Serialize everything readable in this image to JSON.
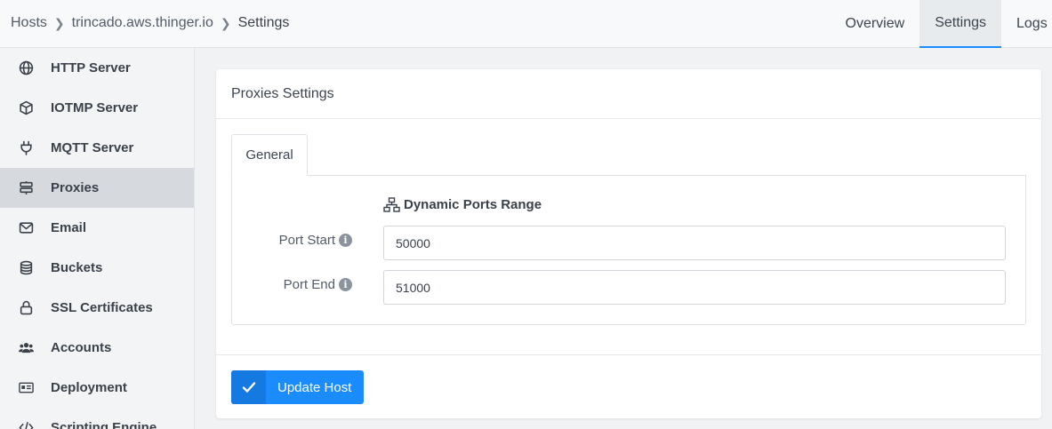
{
  "breadcrumb": {
    "items": [
      "Hosts",
      "trincado.aws.thinger.io",
      "Settings"
    ]
  },
  "top_tabs": [
    {
      "label": "Overview",
      "active": false
    },
    {
      "label": "Settings",
      "active": true
    },
    {
      "label": "Logs",
      "active": false
    }
  ],
  "sidebar": {
    "items": [
      {
        "label": "HTTP Server",
        "icon": "globe-icon"
      },
      {
        "label": "IOTMP Server",
        "icon": "cube-icon"
      },
      {
        "label": "MQTT Server",
        "icon": "plug-icon"
      },
      {
        "label": "Proxies",
        "icon": "signs-icon",
        "active": true
      },
      {
        "label": "Email",
        "icon": "envelope-icon"
      },
      {
        "label": "Buckets",
        "icon": "database-icon"
      },
      {
        "label": "SSL Certificates",
        "icon": "lock-icon"
      },
      {
        "label": "Accounts",
        "icon": "users-icon"
      },
      {
        "label": "Deployment",
        "icon": "id-card-icon"
      },
      {
        "label": "Scripting Engine",
        "icon": "code-icon"
      }
    ]
  },
  "card": {
    "title": "Proxies Settings",
    "tab_label": "General",
    "group_title": "Dynamic Ports Range",
    "fields": {
      "port_start": {
        "label": "Port Start",
        "value": "50000"
      },
      "port_end": {
        "label": "Port End",
        "value": "51000"
      }
    },
    "submit_label": "Update Host"
  },
  "colors": {
    "accent": "#1a8cff",
    "sidebar_active": "#d6dadf"
  }
}
